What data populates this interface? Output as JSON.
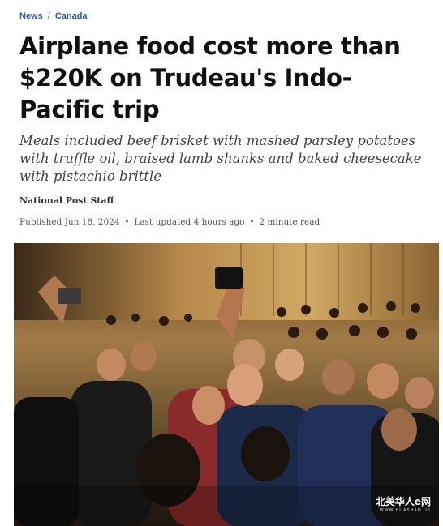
{
  "breadcrumb": {
    "section": "News",
    "separator": "/",
    "subsection": "Canada"
  },
  "article": {
    "headline": "Airplane food cost more than $220K on Trudeau's Indo-Pacific trip",
    "subheadline": "Meals included beef brisket with mashed parsley potatoes with truffle oil, braised lamb shanks and baked cheesecake with pistachio brittle",
    "byline": "National Post Staff",
    "published": "Published Jun 18, 2024",
    "updated": "Last updated 4 hours ago",
    "read_time": "2 minute read",
    "meta_separator": "•"
  },
  "photo": {
    "description_icon": "crowd-selfie-photo"
  },
  "watermark": {
    "main": "北美华人e网",
    "sub": "WWW.HUASHAN.US"
  },
  "colors": {
    "link": "#2b5a9a",
    "headline": "#111111",
    "subhead": "#444444"
  }
}
